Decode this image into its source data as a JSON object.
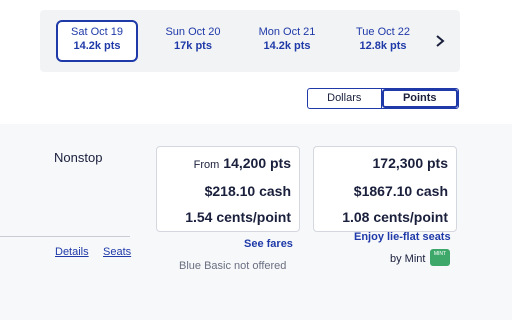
{
  "dates": [
    {
      "day": "Sat Oct 19",
      "pts": "14.2k pts",
      "selected": true
    },
    {
      "day": "Sun Oct 20",
      "pts": "17k pts",
      "selected": false
    },
    {
      "day": "Mon Oct 21",
      "pts": "14.2k pts",
      "selected": false
    },
    {
      "day": "Tue Oct 22",
      "pts": "12.8k pts",
      "selected": false
    }
  ],
  "next_icon": "chevron-right-icon",
  "toggle": {
    "dollars": "Dollars",
    "points": "Points",
    "active": "points"
  },
  "flight": {
    "stops": "Nonstop",
    "details_link": "Details",
    "seats_link": "Seats"
  },
  "fares": [
    {
      "from_label": "From",
      "points": "14,200 pts",
      "cash": "$218.10 cash",
      "value": "1.54 cents/point",
      "link": "See fares",
      "note": "Blue Basic not offered"
    },
    {
      "points": "172,300 pts",
      "cash": "$1867.10 cash",
      "value": "1.08 cents/point",
      "link": "Enjoy lie-flat seats",
      "note": "by Mint",
      "badge": "MINT"
    }
  ],
  "colors": {
    "accent": "#1f3aa8",
    "mint": "#3da86a",
    "band": "#f7f8fa"
  }
}
